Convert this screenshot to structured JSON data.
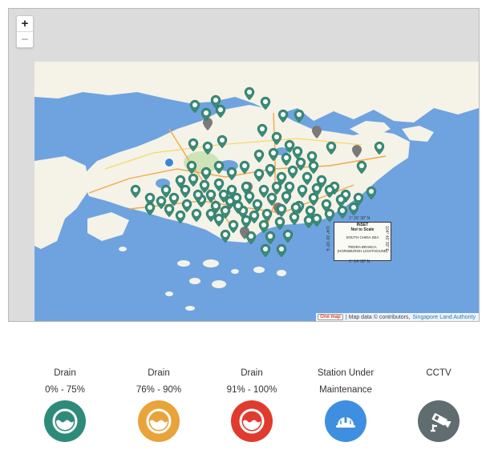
{
  "map": {
    "zoom_in_label": "+",
    "zoom_out_label": "−",
    "attribution": {
      "logo": "One map",
      "text": "| Map data © contributors,",
      "link": "Singapore Land Authority"
    },
    "inset": {
      "title": "INSET",
      "subtitle": "Not to Scale",
      "sea": "SOUTH CHINA SEA",
      "place_line1": "PEDRA BRANCA",
      "place_line2": "(HORSBURGH LIGHTHOUSE)",
      "coord_top": "1° 20' 30\" N",
      "coord_bottom": "1° 14' 30\" N",
      "coord_left": "104° 20' 00\" E",
      "coord_right": "104° 40' 30\" E"
    },
    "colors": {
      "sea": "#6fa3df",
      "land": "#f5f2e8",
      "marker_green": "#3a8b76",
      "marker_gray": "#7a7a7a",
      "marker_blue": "#3c86d6"
    }
  },
  "legend": [
    {
      "line1": "Drain",
      "line2": "0% - 75%",
      "color": "#2e8b7a",
      "icon": "drain-water-icon"
    },
    {
      "line1": "Drain",
      "line2": "76% - 90%",
      "color": "#e8a33a",
      "icon": "drain-water-icon"
    },
    {
      "line1": "Drain",
      "line2": "91% - 100%",
      "color": "#e03b2e",
      "icon": "drain-water-icon"
    },
    {
      "line1": "Station Under",
      "line2": "Maintenance",
      "color": "#3f8fe0",
      "icon": "hard-hat-icon"
    },
    {
      "line1": "CCTV",
      "line2": "",
      "color": "#5f6c70",
      "icon": "cctv-camera-icon"
    }
  ]
}
